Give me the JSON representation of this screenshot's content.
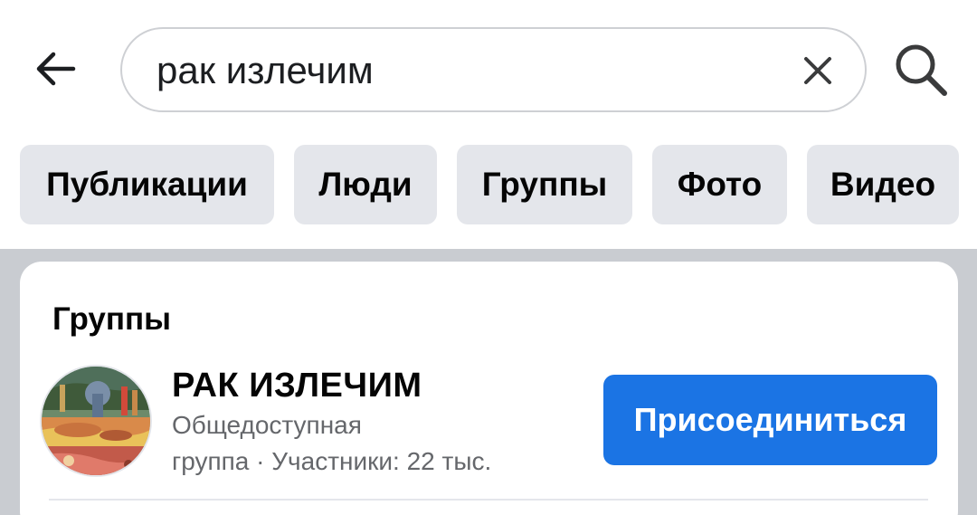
{
  "search": {
    "query": "рак излечим",
    "back_icon": "arrow-left-icon",
    "clear_icon": "close-icon",
    "search_icon": "search-icon"
  },
  "filters": [
    {
      "label": "Публикации"
    },
    {
      "label": "Люди"
    },
    {
      "label": "Группы"
    },
    {
      "label": "Фото"
    },
    {
      "label": "Видео"
    }
  ],
  "groups_section": {
    "title": "Группы",
    "result": {
      "name": "РАК ИЗЛЕЧИМ",
      "privacy": "Общедоступная",
      "details": "группа · Участники: 22 тыс.",
      "join_label": "Присоединиться"
    }
  },
  "colors": {
    "accent": "#1b74e4",
    "chip_bg": "#e4e6eb",
    "feed_bg": "#c9ccd1",
    "secondary_text": "#65676b"
  }
}
